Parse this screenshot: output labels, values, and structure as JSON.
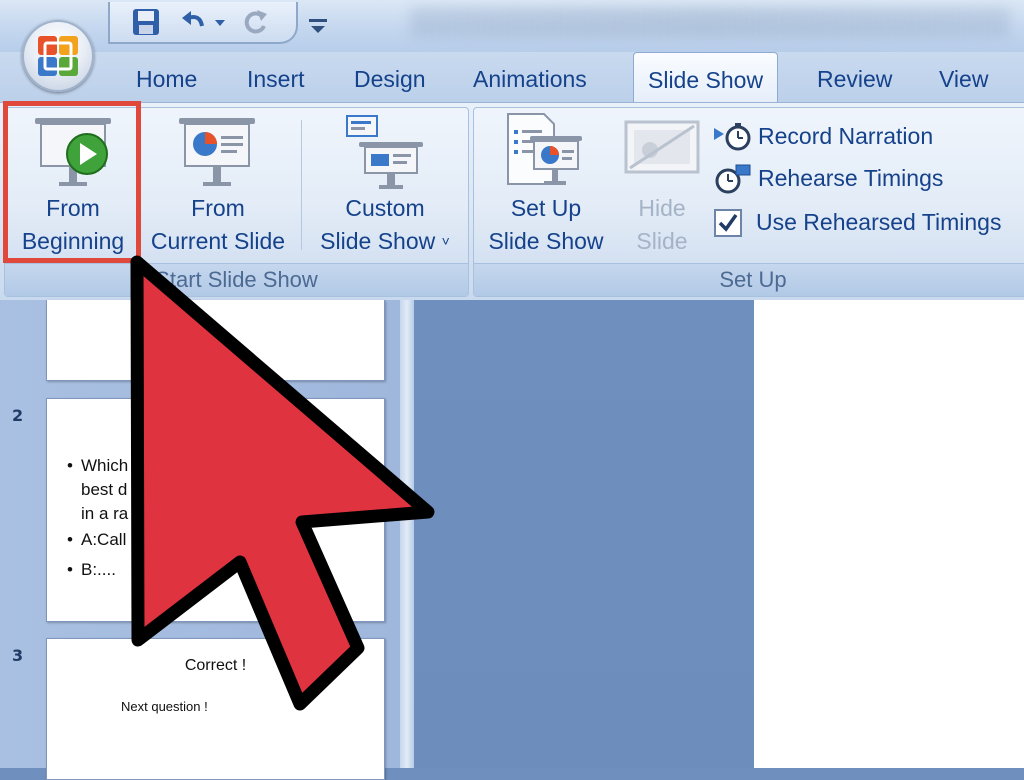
{
  "quick_access": {
    "save_icon": "save-icon",
    "undo_icon": "undo-icon",
    "redo_icon": "redo-icon",
    "customize_icon": "customize-qat-icon"
  },
  "tabs": [
    {
      "label": "Home"
    },
    {
      "label": "Insert"
    },
    {
      "label": "Design"
    },
    {
      "label": "Animations"
    },
    {
      "label": "Slide Show",
      "active": true
    },
    {
      "label": "Review"
    },
    {
      "label": "View"
    }
  ],
  "ribbon": {
    "start_group": {
      "label": "Start Slide Show",
      "from_beginning": {
        "line1": "From",
        "line2": "Beginning"
      },
      "from_current": {
        "line1": "From",
        "line2": "Current Slide"
      },
      "custom_show": {
        "line1": "Custom",
        "line2": "Slide Show",
        "arrow": "˅"
      }
    },
    "setup_group": {
      "label": "Set Up",
      "setup_show": {
        "line1": "Set Up",
        "line2": "Slide Show"
      },
      "hide_slide": {
        "line1": "Hide",
        "line2": "Slide"
      },
      "record_narration": "Record Narration",
      "rehearse_timings": "Rehearse Timings",
      "use_rehearsed": "Use Rehearsed Timings",
      "use_rehearsed_checked": true
    }
  },
  "slides": [
    {
      "number": "2",
      "bullets": [
        "Which",
        "best d",
        "in a ra",
        "A:Call",
        "B:...."
      ]
    },
    {
      "number": "3",
      "title": "Correct !",
      "subtitle": "Next question  !"
    }
  ],
  "colors": {
    "highlight": "#e0483c",
    "cursor_fill": "#e03340",
    "tab_text": "#15428b"
  }
}
